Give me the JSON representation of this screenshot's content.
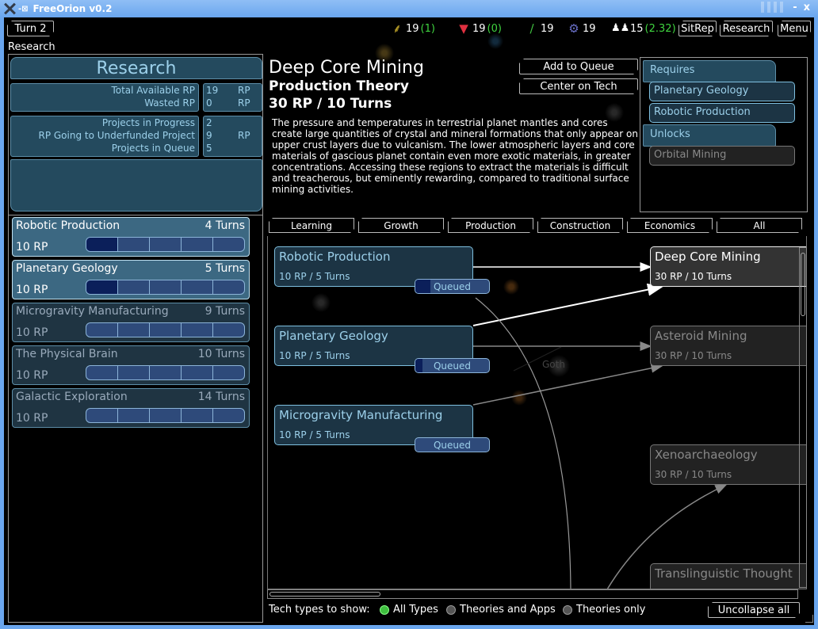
{
  "window": {
    "title": "FreeOrion v0.2",
    "minimize_label": "-",
    "close_label": "x"
  },
  "topbar": {
    "turn_label": "Turn 2",
    "screen_label": "Research",
    "resources": [
      {
        "icon": "food-icon",
        "glyph": "⸙",
        "value": "19",
        "delta": "(1)",
        "color": "#e0c030"
      },
      {
        "icon": "minerals-icon",
        "glyph": "▼",
        "value": "19",
        "delta": "(0)",
        "color": "#e03040"
      },
      {
        "icon": "research-icon",
        "glyph": "∕",
        "value": "19",
        "delta": "",
        "color": "#40c040"
      },
      {
        "icon": "industry-icon",
        "glyph": "⚙",
        "value": "19",
        "delta": "",
        "color": "#6a70c8"
      },
      {
        "icon": "population-icon",
        "glyph": "♟♟",
        "value": "15",
        "delta": "(2.32)",
        "color": "#ffffff"
      }
    ],
    "sitrep_label": "SitRep",
    "research_label": "Research",
    "menu_label": "Menu"
  },
  "research_panel": {
    "title": "Research",
    "stats": [
      {
        "label": "Total Available RP",
        "value": "19",
        "unit": "RP"
      },
      {
        "label": "Wasted RP",
        "value": "0",
        "unit": "RP"
      }
    ],
    "stats2": [
      {
        "label": "Projects in Progress",
        "value": "2",
        "unit": ""
      },
      {
        "label": "RP Going to Underfunded Project",
        "value": "9",
        "unit": "RP"
      },
      {
        "label": "Projects in Queue",
        "value": "5",
        "unit": ""
      }
    ],
    "queue": [
      {
        "name": "Robotic Production",
        "turns": "4 Turns",
        "rp": "10 RP",
        "progress": 0.2,
        "active": true
      },
      {
        "name": "Planetary Geology",
        "turns": "5 Turns",
        "rp": "10 RP",
        "progress": 0.2,
        "active": true
      },
      {
        "name": "Microgravity Manufacturing",
        "turns": "9 Turns",
        "rp": "10 RP",
        "progress": 0,
        "active": false
      },
      {
        "name": "The Physical Brain",
        "turns": "10 Turns",
        "rp": "10 RP",
        "progress": 0,
        "active": false
      },
      {
        "name": "Galactic Exploration",
        "turns": "14 Turns",
        "rp": "10 RP",
        "progress": 0,
        "active": false
      }
    ]
  },
  "detail": {
    "name": "Deep Core Mining",
    "type": "Production Theory",
    "cost": "30 RP / 10 Turns",
    "description": "The pressure and temperatures in terrestrial planet mantles and cores create large quantities of crystal and mineral formations that only appear on upper crust layers due to vulcanism.  The lower atmospheric layers and core materials of gascious planet contain even more exotic materials, in greater concentrations.  Accessing these regions to extract the materials is difficult and treacherous, but eminently rewarding, compared to traditional surface mining activities.",
    "add_to_queue_label": "Add to Queue",
    "center_on_tech_label": "Center on Tech",
    "requires_label": "Requires",
    "requires": [
      "Planetary Geology",
      "Robotic Production"
    ],
    "unlocks_label": "Unlocks",
    "unlocks": [
      "Orbital Mining"
    ]
  },
  "categories": [
    "Learning",
    "Growth",
    "Production",
    "Construction",
    "Economics",
    "All"
  ],
  "tree": {
    "nodes": [
      {
        "name": "Robotic Production",
        "cost": "10 RP / 5 Turns",
        "style": "blue",
        "queued": "Queued",
        "queued_progress": 0.2
      },
      {
        "name": "Planetary Geology",
        "cost": "10 RP / 5 Turns",
        "style": "blue",
        "queued": "Queued",
        "queued_progress": 0.1
      },
      {
        "name": "Microgravity Manufacturing",
        "cost": "10 RP / 5 Turns",
        "style": "blue",
        "queued": "Queued",
        "queued_progress": 0
      },
      {
        "name": "Deep Core Mining",
        "cost": "30 RP / 10 Turns",
        "style": "sel"
      },
      {
        "name": "Asteroid Mining",
        "cost": "30 RP / 10 Turns",
        "style": "grey"
      },
      {
        "name": "Xenoarchaeology",
        "cost": "30 RP / 10 Turns",
        "style": "grey"
      },
      {
        "name": "Translinguistic Thought",
        "cost": "",
        "style": "grey"
      }
    ],
    "map_label": "Goth"
  },
  "bottom": {
    "tech_types_label": "Tech types to show:",
    "options": [
      {
        "label": "All Types",
        "selected": true
      },
      {
        "label": "Theories and Apps",
        "selected": false
      },
      {
        "label": "Theories only",
        "selected": false
      }
    ],
    "uncollapse_label": "Uncollapse all"
  }
}
